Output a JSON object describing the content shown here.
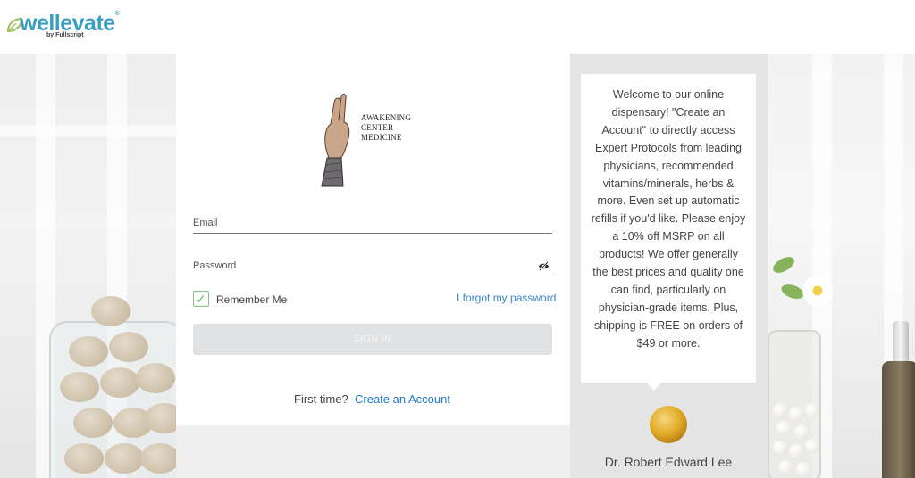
{
  "brand": {
    "logo_text": "wellevate",
    "logo_tm": "®",
    "logo_by": "by Fullscript"
  },
  "clinic": {
    "line1": "AWAKENING",
    "line2": "CENTER",
    "line3": "MEDICINE"
  },
  "form": {
    "email_label": "Email",
    "password_label": "Password",
    "remember_label": "Remember Me",
    "remember_checked": true,
    "forgot_link": "I forgot my password",
    "signin_label": "SIGN IN",
    "first_time_text": "First time?",
    "create_account_link": "Create an Account"
  },
  "sidebar": {
    "message": "Welcome to our online dispensary! \"Create an Account\" to directly access Expert Protocols from leading physicians, recommended vitamins/minerals, herbs & more. Even set up automatic refills if you'd like. Please enjoy a 10% off MSRP on all products! We offer generally the best prices and quality one can find, particularly on physician-grade items. Plus, shipping is FREE on orders of $49 or more.",
    "doctor_name": "Dr. Robert Edward Lee"
  },
  "icons": {
    "eye": "eye-slash-icon",
    "check": "checkmark-icon",
    "leaf": "leaf-icon"
  },
  "colors": {
    "brand_blue": "#3a9fbf",
    "link_blue": "#1f78c8",
    "checkbox_green": "#6bbf6f",
    "button_gray": "#dfe1e3"
  }
}
